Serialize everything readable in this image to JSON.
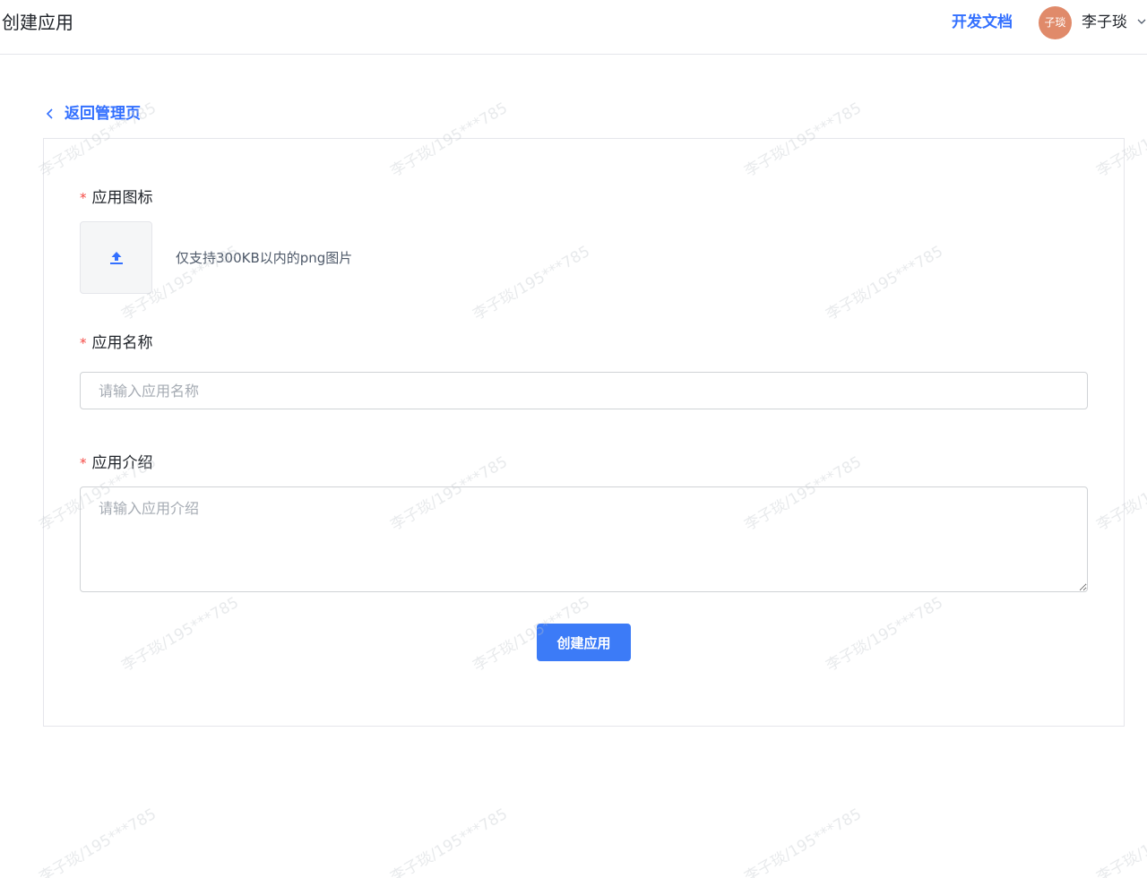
{
  "header": {
    "title": "创建应用",
    "docs_link": "开发文档",
    "avatar_text": "子琰",
    "user_name": "李子琰"
  },
  "back": {
    "label": "返回管理页"
  },
  "form": {
    "icon_label": "应用图标",
    "icon_hint": "仅支持300KB以内的png图片",
    "name_label": "应用名称",
    "name_placeholder": "请输入应用名称",
    "name_value": "",
    "intro_label": "应用介绍",
    "intro_placeholder": "请输入应用介绍",
    "intro_value": "",
    "required_mark": "*",
    "submit_label": "创建应用"
  },
  "watermark": {
    "text": "李子琰/195***785"
  },
  "colors": {
    "accent": "#3370ff",
    "button": "#3c7bf7",
    "required": "#f54a45",
    "avatar": "#e08a6a"
  },
  "icons": {
    "back": "chevron-left-icon",
    "upload": "upload-icon",
    "user_menu": "chevron-down-icon"
  }
}
